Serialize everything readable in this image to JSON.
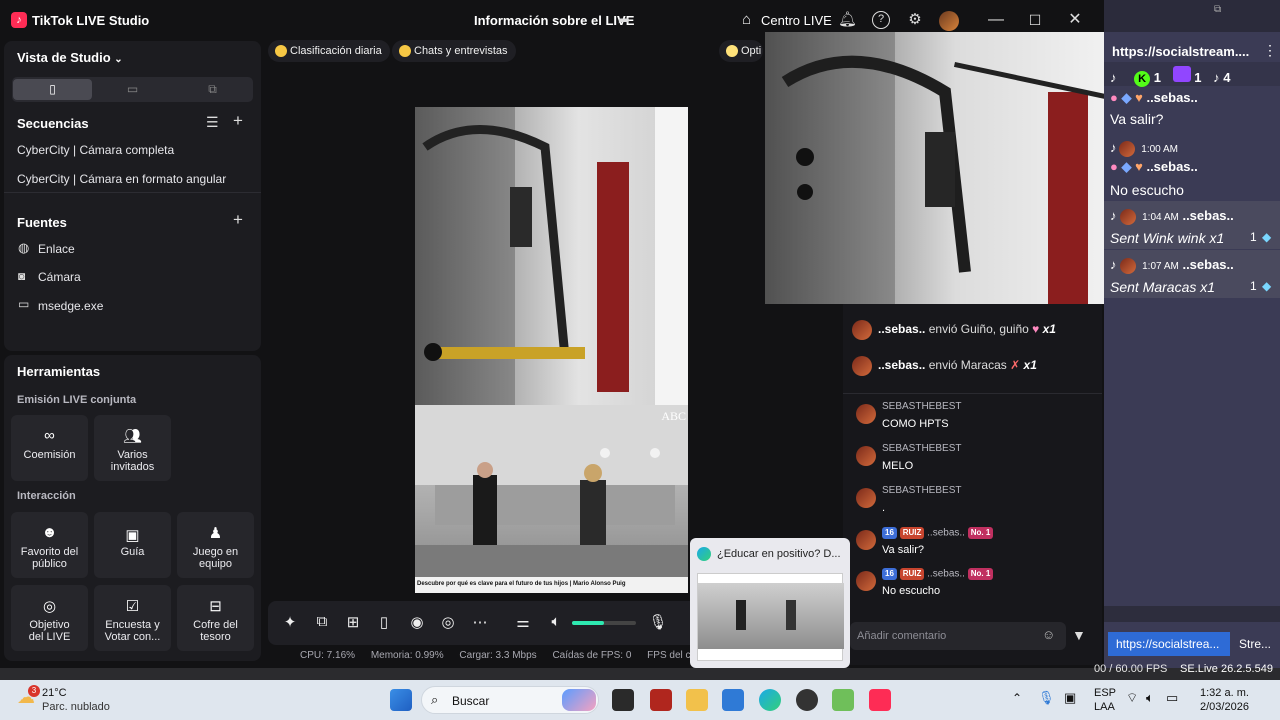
{
  "window": {
    "app_name": "TikTok LIVE Studio",
    "center_title": "Información sobre el LIVE",
    "centro_live": "Centro LIVE"
  },
  "studio": {
    "view_label": "Vista de Studio",
    "sequences_title": "Secuencias",
    "sequences": [
      "CyberCity | Cámara completa",
      "CyberCity | Cámara en formato angular"
    ],
    "sources_title": "Fuentes",
    "sources": [
      {
        "label": "Enlace",
        "icon": "globe-icon"
      },
      {
        "label": "Cámara",
        "icon": "camera-icon"
      },
      {
        "label": "msedge.exe",
        "icon": "window-icon"
      }
    ]
  },
  "tools": {
    "title": "Herramientas",
    "cohost_title": "Emisión LIVE conjunta",
    "cohost": [
      "Coemisión",
      "Varios invitados"
    ],
    "interaction_title": "Interacción",
    "interaction": [
      "Favorito del público",
      "Guía",
      "Juego en equipo",
      "Objetivo del LIVE",
      "Encuesta y Votar con...",
      "Cofre del tesoro"
    ]
  },
  "chips": [
    "Clasificación diaria",
    "Chats y entrevistas",
    "Opti"
  ],
  "preview": {
    "watermark": "ABC",
    "caption": "Descubre por qué es clave para el futuro de tus hijos | Mario Alonso Puig"
  },
  "volume_level": 0.5,
  "stats": {
    "cpu": "CPU:  7.16%",
    "memoria": "Memoria:  0.99%",
    "cargar": "Cargar:  3.3 Mbps",
    "caidas": "Caídas de FPS:  0",
    "fps": "FPS del co"
  },
  "chat": {
    "gifts": [
      {
        "user": "..sebas..",
        "text": "envió Guiño, guiño",
        "count": "x1"
      },
      {
        "user": "..sebas..",
        "text": "envió Maracas",
        "count": "x1"
      }
    ],
    "messages": [
      {
        "user": "SEBASTHEBEST",
        "text": "COMO HPTS"
      },
      {
        "user": "SEBASTHEBEST",
        "text": "MELO"
      },
      {
        "user": "SEBASTHEBEST",
        "text": "."
      },
      {
        "user": "..sebas..",
        "level": "16",
        "fan": "RUIZ",
        "rank": "No. 1",
        "text": "Va salir?"
      },
      {
        "user": "..sebas..",
        "level": "16",
        "fan": "RUIZ",
        "rank": "No. 1",
        "text": "No escucho"
      }
    ],
    "placeholder": "Añadir comentario"
  },
  "socialstream": {
    "url": "https://socialstream....",
    "counts": [
      "1",
      "1",
      "4"
    ],
    "rows": [
      {
        "name": "..sebas..",
        "time": "",
        "msg": "Va salir?"
      },
      {
        "name": "..sebas..",
        "time": "1:00 AM",
        "msg": "No escucho"
      },
      {
        "name": "..sebas..",
        "time": "1:04 AM",
        "msg": "Sent Wink wink x1",
        "gift": "1"
      },
      {
        "name": "..sebas..",
        "time": "1:07 AM",
        "msg": "Sent Maracas x1",
        "gift": "1"
      }
    ],
    "tab1": "https://socialstrea...",
    "tab2": "Stre...",
    "fps": "00 / 60.00 FPS",
    "version": "SE.Live 26.2.5.549"
  },
  "thumbnail": {
    "title": "¿Educar en positivo? D..."
  },
  "taskbar": {
    "weather_badge": "3",
    "temp": "21°C",
    "weather": "Parc. nublado",
    "search": "Buscar",
    "lang1": "ESP",
    "lang2": "LAA",
    "time": "1:32 a. m.",
    "date": "2/03/2026"
  }
}
